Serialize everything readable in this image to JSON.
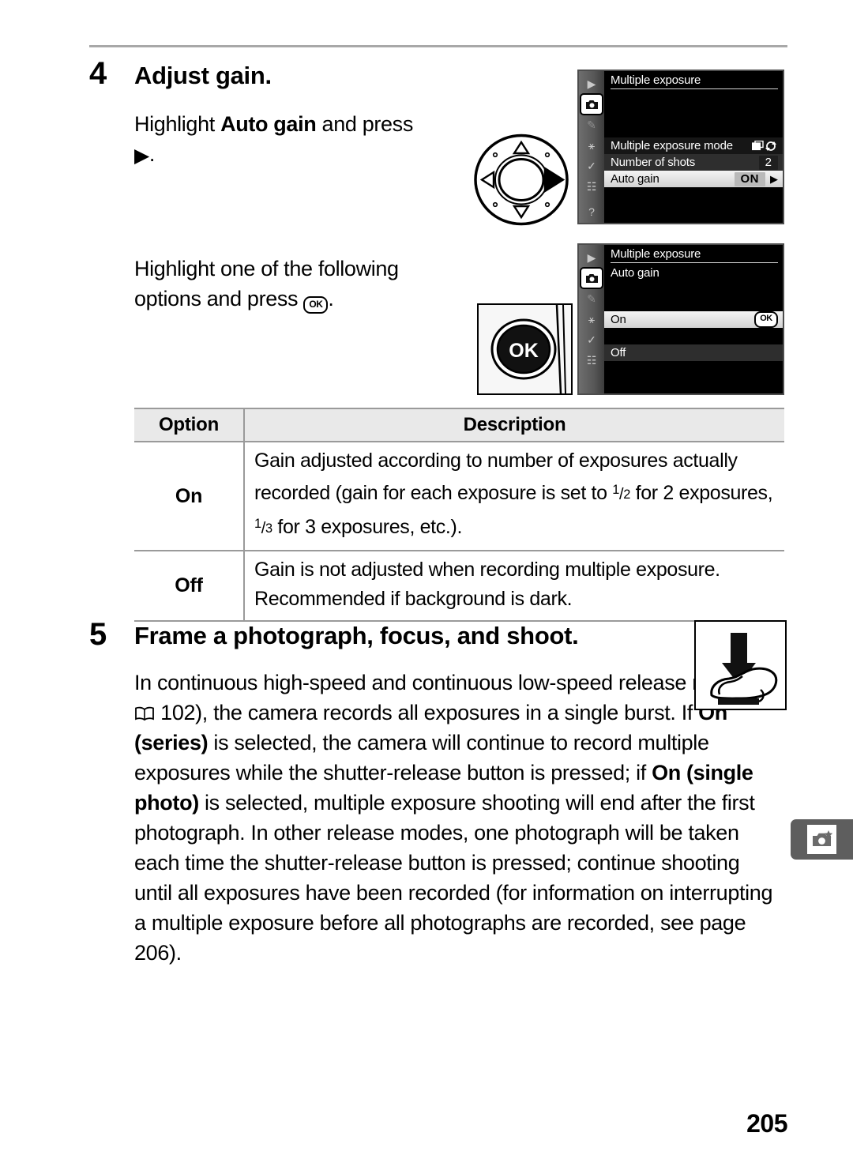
{
  "page": {
    "number": "205"
  },
  "steps": [
    {
      "number": "4",
      "title": "Adjust gain.",
      "para1_a": "Highlight ",
      "para1_b": "Auto gain",
      "para1_c": " and press",
      "para1_d": ".",
      "para2_a": "Highlight one of the following options and press",
      "para2_b": "."
    },
    {
      "number": "5",
      "title": "Frame a photograph, focus, and shoot.",
      "p_1": "In continuous high-speed and continuous low-speed release modes (",
      "p_2": " 102), the camera records all exposures in a single burst.  If ",
      "p_3": "On (series)",
      "p_4": " is selected, the camera will continue to record multiple exposures while the shutter-release button is pressed; if ",
      "p_5": "On (single photo)",
      "p_6": " is selected, multiple exposure shooting will end after the first photograph.  In other release modes, one photograph will be taken each time the shutter-release button is pressed; continue shooting until all exposures have been recorded (for information on interrupting a multiple exposure before all photographs are recorded, see page 206)."
    }
  ],
  "lcd_screens": [
    {
      "title": "Multiple exposure",
      "rows": [
        {
          "label": "Multiple exposure mode",
          "value": "",
          "value_kind": "mode-icons"
        },
        {
          "label": "Number of shots",
          "value": "2",
          "value_kind": "dark-box"
        },
        {
          "label": "Auto gain",
          "value": "ON",
          "value_kind": "light-box",
          "arrow": "▶",
          "highlighted": true
        }
      ],
      "sidebar_icons": [
        "playback-icon",
        "shooting-menu-icon",
        "custom-settings-icon",
        "setup-menu-icon",
        "retouch-icon",
        "my-menu-icon",
        "help-icon"
      ]
    },
    {
      "title": "Multiple exposure",
      "subtitle": "Auto gain",
      "rows": [
        {
          "label": "On",
          "badge": "OK",
          "highlighted": true
        },
        {
          "label": "Off",
          "badge": "",
          "highlighted": false
        }
      ],
      "sidebar_icons": [
        "playback-icon",
        "shooting-menu-icon",
        "custom-settings-icon",
        "setup-menu-icon",
        "retouch-icon",
        "my-menu-icon"
      ]
    }
  ],
  "options_table": {
    "headers": {
      "option": "Option",
      "description": "Description"
    },
    "rows": [
      {
        "option": "On",
        "desc_1": "Gain adjusted according to number of exposures actually recorded (gain for each exposure is set to ",
        "frac1_num": "1",
        "frac1_den": "2",
        "desc_2": " for 2 exposures, ",
        "frac2_num": "1",
        "frac2_den": "3",
        "desc_3": " for 3 exposures, etc.)."
      },
      {
        "option": "Off",
        "desc_1": "Gain is not adjusted when recording multiple exposure. Recommended if background is dark.",
        "frac1_num": "",
        "frac1_den": "",
        "desc_2": "",
        "frac2_num": "",
        "frac2_den": "",
        "desc_3": ""
      }
    ]
  },
  "side_tab": {
    "icon": "camera-star-icon"
  },
  "colors": {
    "rule": "#a8a8a8",
    "table_header_bg": "#e9e9e9",
    "table_border": "#9a9a9a",
    "lcd_bg": "#000000",
    "lcd_highlight": "#e3e3e3",
    "side_tab_bg": "#5e5e5e"
  }
}
